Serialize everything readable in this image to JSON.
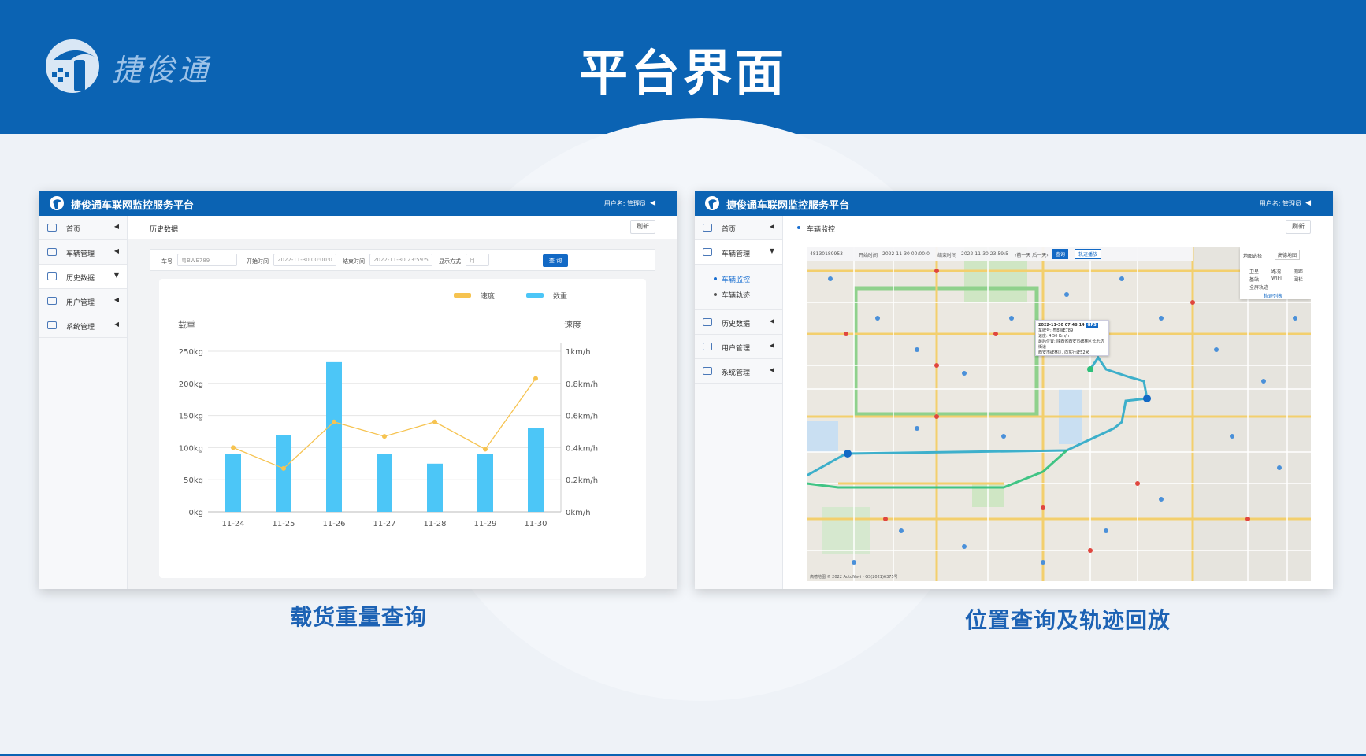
{
  "banner": {
    "title": "平台界面",
    "logo_text": "捷俊通"
  },
  "app": {
    "title": "捷俊通车联网监控服务平台",
    "user_label": "用户名: 管理员",
    "collapse_icon": "◀"
  },
  "left_panel": {
    "nav": [
      {
        "label": "首页",
        "icon": "home-icon"
      },
      {
        "label": "车辆管理",
        "icon": "truck-icon"
      },
      {
        "label": "历史数据",
        "icon": "line-chart-icon"
      },
      {
        "label": "用户管理",
        "icon": "list-icon"
      },
      {
        "label": "系统管理",
        "icon": "monitor-icon"
      }
    ],
    "breadcrumb": "历史数据",
    "refresh": "刷新",
    "filter": {
      "plate_label": "车号",
      "plate_value": "粤BWE789",
      "start_label": "开始时间",
      "start_value": "2022-11-30 00:00:0",
      "end_label": "结束时间",
      "end_value": "2022-11-30 23:59:5",
      "display_label": "显示方式",
      "display_value": "月",
      "query": "查 询"
    },
    "caption": "载货重量查询"
  },
  "right_panel": {
    "nav": [
      {
        "label": "首页"
      },
      {
        "label": "车辆管理"
      },
      {
        "label": "历史数据"
      },
      {
        "label": "用户管理"
      },
      {
        "label": "系统管理"
      }
    ],
    "sub_items": [
      "车辆监控",
      "车辆轨迹"
    ],
    "breadcrumb": "车辆监控",
    "refresh": "刷新",
    "mapbar": {
      "device": "48130189953",
      "start_label": "开始时间",
      "start_value": "2022-11-30 00:00:0",
      "end_label": "结束时间",
      "end_value": "2022-11-30 23:59:5",
      "prev_next": "‹前一天  后一天›",
      "query": "查询",
      "playback": "轨迹播放"
    },
    "layer_box": {
      "title": "地图选择",
      "select": "高德地图",
      "options": [
        "卫星",
        "路况",
        "测距",
        "基站",
        "WIFI",
        "围栏",
        "全屏轨迹"
      ],
      "link": "轨迹列表"
    },
    "popup": {
      "time": "2022-11-30 07:48:14",
      "badge": "GPS",
      "plate": "车牌号: 粤BWE789",
      "speed": "速度: 4.50 Km/h",
      "location": "最后位置: 陕西省西安市碑林区长乐坊街道",
      "location2": "西安市碑林区, 向东行驶52米"
    },
    "map_footer": "高德地图 © 2022 AutoNavi - GS(2021)6375号",
    "caption": "位置查询及轨迹回放"
  },
  "chart_data": {
    "type": "bar",
    "categories": [
      "11-24",
      "11-25",
      "11-26",
      "11-27",
      "11-28",
      "11-29",
      "11-30"
    ],
    "series": [
      {
        "name": "数重",
        "type": "bar",
        "axis": "left",
        "values": [
          90,
          120,
          233,
          90,
          75,
          90,
          131
        ]
      },
      {
        "name": "速度",
        "type": "line",
        "axis": "right",
        "values": [
          0.4,
          0.27,
          0.56,
          0.47,
          0.56,
          0.39,
          0.83
        ]
      }
    ],
    "ylabel_left": "载重",
    "ylabel_right": "速度",
    "left_ticks": [
      "0kg",
      "50kg",
      "100kg",
      "150kg",
      "200kg",
      "250kg"
    ],
    "right_ticks": [
      "0km/h",
      "0.2km/h",
      "0.4km/h",
      "0.6km/h",
      "0.8km/h",
      "1km/h"
    ],
    "ylim_left": [
      0,
      250
    ],
    "ylim_right": [
      0,
      1
    ],
    "colors": {
      "bar": "#4cc6f7",
      "line": "#f6c350"
    },
    "legend_position": "top-right",
    "grid": true
  }
}
